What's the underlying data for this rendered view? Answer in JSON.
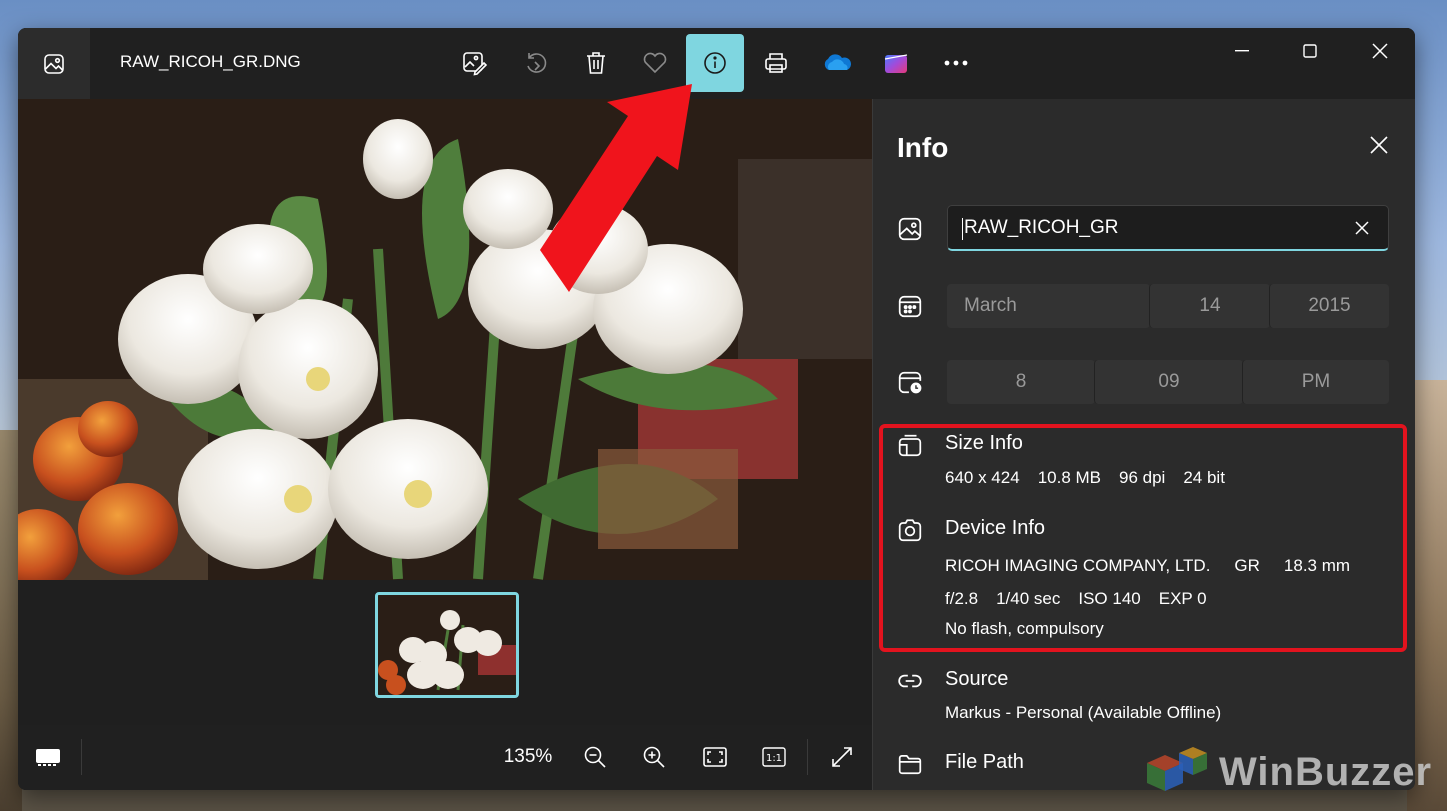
{
  "window": {
    "file_name": "RAW_RICOH_GR.DNG"
  },
  "toolbar": {
    "icons": [
      "edit-image-icon",
      "rotate-icon",
      "delete-icon",
      "favorite-icon",
      "info-icon",
      "print-icon",
      "onedrive-icon",
      "clipchamp-icon",
      "more-icon"
    ],
    "active": "info-icon"
  },
  "bottombar": {
    "zoom": "135%"
  },
  "info_panel": {
    "title": "Info",
    "file_name_value": "RAW_RICOH_GR",
    "date": {
      "month": "March",
      "day": "14",
      "year": "2015"
    },
    "time": {
      "hour": "8",
      "minute": "09",
      "period": "PM"
    },
    "size_info": {
      "title": "Size Info",
      "dimensions": "640 x 424",
      "file_size": "10.8 MB",
      "dpi": "96 dpi",
      "bit_depth": "24 bit"
    },
    "device_info": {
      "title": "Device Info",
      "maker": "RICOH IMAGING COMPANY, LTD.",
      "model": "GR",
      "focal_length": "18.3 mm",
      "aperture": "f/2.8",
      "exposure_time": "1/40 sec",
      "iso": "ISO 140",
      "exposure_bias": "EXP 0",
      "flash": "No flash, compulsory"
    },
    "source": {
      "title": "Source",
      "value": "Markus - Personal (Available Offline)"
    },
    "file_path": {
      "title": "File Path"
    }
  },
  "watermark": {
    "text": "WinBuzzer"
  },
  "colors": {
    "accent": "#7fd6e0",
    "highlight": "#e3131e",
    "panel": "#2b2b2b",
    "window": "#202020"
  }
}
